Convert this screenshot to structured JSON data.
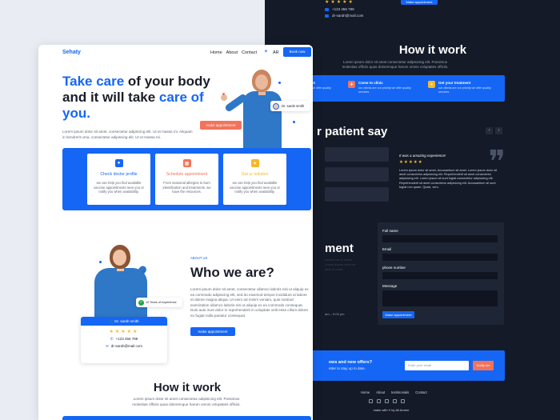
{
  "dark_page": {
    "rating_stars": "★★★★★",
    "phone": "+123 456 789",
    "email": "dr-sarah@mail.com",
    "top_button": "Make appointment",
    "how_title": "How it work",
    "how_sub": "Lorem ipsum dolor sit amet consectetur adipisicing elit. Possimus molestias officiis quas doloremque harum omnis voluptates officiis.",
    "steps": [
      {
        "title": "Book an appointment",
        "desc": "our clients are our priority we offer quality services.",
        "color": "#f2735b",
        "icon": "calendar-icon"
      },
      {
        "title": "Come to clinic",
        "desc": "our clients are our priority we offer quality services.",
        "color": "#f2735b",
        "icon": "hospital-icon"
      },
      {
        "title": "Get your treatment",
        "desc": "our clients are our priority we offer quality services.",
        "color": "#f5b829",
        "icon": "bulb-icon"
      }
    ],
    "patient_say": "r patient say",
    "prev_arrow": "‹",
    "next_arrow": "›",
    "review": {
      "heading": "It was a amazing experience!",
      "stars": "★★★★★",
      "body": "Lorem ipsum dolor sit amet, Accusantium sit amet. Lorem ipsum dolor sit amet consectetur adipisicing elit. Reprehenderit sit amet consectetur adipisicing elit. Lorem ipsum sit sunt fugiat consectetur adipisicing elit. Reprehenderit sit amet consectetur adipisicing elit. Accusantium sit sunt fugiat non quam. Quasi, vero."
    },
    "quote_mark": "❞",
    "appointment_word": "ment",
    "form": {
      "full_name": "Full name",
      "email": "Email",
      "phone": "phone number",
      "message": "Message",
      "submit": "Make appointment"
    },
    "dim_lines": [
      "contact us or make",
      "Lorem ipsum dolor sit",
      "ame ut amet."
    ],
    "hours": "am – 9:00 pm",
    "newsletter": {
      "title": "ews and new offers?",
      "sub": "etter to stay up to date.",
      "placeholder": "Enter your email",
      "button": "Notify me"
    },
    "footer_nav": [
      "Home",
      "About",
      "testimonials",
      "Contact"
    ],
    "made_by": "make with",
    "heart": "♥",
    "author": "by Ali Ameer"
  },
  "light_page": {
    "logo": "Sehaty",
    "menu": [
      "Home",
      "About",
      "Contact"
    ],
    "theme_icon": "☀",
    "lang": "AR",
    "book_now": "Book now",
    "hero": {
      "title_part1": "Take care",
      "title_part2": " of your body and it will take ",
      "title_part3": "care of you.",
      "sub": "Lorem ipsum dolor sit amet, consectetur adipiscing elit. Ut et massa mi. Aliquam in hendrerit urna, consectetur adipiscing elit. Ut et massa mi.",
      "cta": "make appointment",
      "doctor_tag": "Dr. sarah smith"
    },
    "services": [
      {
        "title": "Check doctor profile",
        "desc": "we can help you find available vaccine appointments near you or notify you when availability.",
        "color": "#1566f5",
        "icon": "person-icon"
      },
      {
        "title": "Schedule appointment",
        "desc": "From seasonal allergies to burn identification and treatments, we have the resources.",
        "color": "#f2735b",
        "icon": "calendar-icon"
      },
      {
        "title": "Get ur solution",
        "desc": "we can help you find available vaccine appointments near you or notify you when availability.",
        "color": "#f5b829",
        "icon": "bulb-icon"
      }
    ],
    "about": {
      "label": "ABOUT US",
      "title": "Who we are?",
      "body": "Lorem ipsum dolor sit amet, consectetur ullamco laboris nisi ut aliquip ex ea commodo adipiscing elit, sed do eiusmod tempor incididunt ut labore et dolore magna aliqua. Ut enim ad minim veniam, quis nostrud exercitation ullamco laboris nisi ut aliquip ex ea commodo consequat. Duis aute irure dolor in reprehenderit in voluptate velit esse cillum dolore eu fugiat nulla pariatur consequat.",
      "button": "make appointment",
      "experience": "10 Years of experience",
      "doctor_name": "Dr. sarah smith",
      "stars": "★★★★★",
      "phone": "+123 456 789",
      "email": "dr-sarah@mail.com"
    },
    "how_title": "How it work",
    "how_sub": "Lorem ipsum dolor sit amet consectetur adipisicing elit. Possimus molestias officiis quas doloremque harum omnis voluptates officiis."
  }
}
